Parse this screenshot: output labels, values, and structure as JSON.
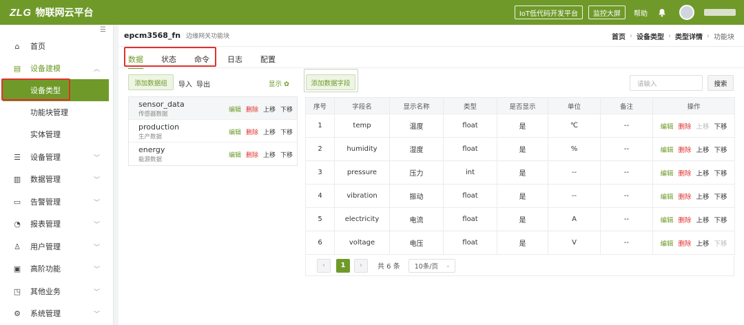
{
  "app": {
    "logo_mark": "ZLG",
    "title": "物联网云平台",
    "btn_lowcode": "IoT低代码开发平台",
    "btn_dashboard": "监控大屏",
    "help": "帮助"
  },
  "sidebar": {
    "collapse_glyph": "☰",
    "items": [
      {
        "label": "首页",
        "icon": "⌂"
      },
      {
        "label": "设备建模",
        "icon": "▤",
        "arrow": "︿"
      },
      {
        "label": "设备类型"
      },
      {
        "label": "功能块管理"
      },
      {
        "label": "实体管理"
      },
      {
        "label": "设备管理",
        "icon": "☰",
        "arrow": "﹀"
      },
      {
        "label": "数据管理",
        "icon": "▥",
        "arrow": "﹀"
      },
      {
        "label": "告警管理",
        "icon": "▭",
        "arrow": "﹀"
      },
      {
        "label": "报表管理",
        "icon": "◔",
        "arrow": "﹀"
      },
      {
        "label": "用户管理",
        "icon": "♙",
        "arrow": "﹀"
      },
      {
        "label": "高阶功能",
        "icon": "▣",
        "arrow": "﹀"
      },
      {
        "label": "其他业务",
        "icon": "◳",
        "arrow": "﹀"
      },
      {
        "label": "系统管理",
        "icon": "⚙",
        "arrow": "﹀"
      }
    ]
  },
  "header": {
    "title": "epcm3568_fn",
    "subtitle": "边缘网关功能块",
    "breadcrumb": [
      "首页",
      "设备类型",
      "类型详情",
      "功能块"
    ],
    "breadcrumb_sep": "›"
  },
  "tabs": [
    "数据",
    "状态",
    "命令",
    "日志",
    "配置"
  ],
  "left_panel": {
    "add_group": "添加数据组",
    "import": "导入",
    "export": "导出",
    "show": "显示 ✿",
    "groups": [
      {
        "name": "sensor_data",
        "desc": "传感器数据"
      },
      {
        "name": "production",
        "desc": "生产数据"
      },
      {
        "name": "energy",
        "desc": "能源数据"
      }
    ],
    "actions": {
      "edit": "编辑",
      "delete": "删除",
      "up": "上移",
      "down": "下移"
    }
  },
  "right_panel": {
    "add_field": "添加数据字段",
    "search_placeholder": "请输入",
    "search_btn": "搜索",
    "columns": [
      "序号",
      "字段名",
      "显示名称",
      "类型",
      "是否显示",
      "单位",
      "备注",
      "操作"
    ],
    "rows": [
      [
        "1",
        "temp",
        "温度",
        "float",
        "是",
        "℃",
        "--"
      ],
      [
        "2",
        "humidity",
        "湿度",
        "float",
        "是",
        "%",
        "--"
      ],
      [
        "3",
        "pressure",
        "压力",
        "int",
        "是",
        "--",
        "--"
      ],
      [
        "4",
        "vibration",
        "振动",
        "float",
        "是",
        "--",
        "--"
      ],
      [
        "5",
        "electricity",
        "电流",
        "float",
        "是",
        "A",
        "--"
      ],
      [
        "6",
        "voltage",
        "电压",
        "float",
        "是",
        "V",
        "--"
      ]
    ],
    "actions": {
      "edit": "编辑",
      "delete": "删除",
      "up": "上移",
      "down": "下移"
    }
  },
  "pagination": {
    "prev": "‹",
    "next": "›",
    "current": "1",
    "total": "共 6 条",
    "page_size": "10条/页",
    "chevron": "⌄"
  },
  "colors": {
    "brand": "#6f9a2a",
    "danger": "#e0302b",
    "highlight_box": "#e0302b"
  }
}
